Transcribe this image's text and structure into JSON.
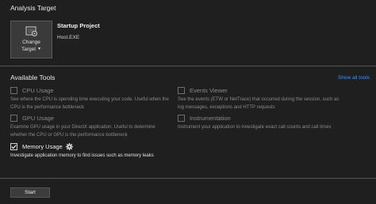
{
  "analysis_target": {
    "title": "Analysis Target",
    "change_target_line1": "Change",
    "change_target_line2": "Target",
    "project_title": "Startup Project",
    "project_exe": "Host.EXE"
  },
  "available_tools": {
    "title": "Available Tools",
    "show_all": "Show all tools",
    "tools": [
      {
        "label": "CPU Usage",
        "checked": false,
        "enabled": false,
        "description": "See where the CPU is spending time executing your code. Useful when the CPU is the performance bottleneck"
      },
      {
        "label": "GPU Usage",
        "checked": false,
        "enabled": false,
        "description": "Examine GPU usage in your DirectX application. Useful to determine whether the CPU or GPU is the performance bottleneck"
      },
      {
        "label": "Memory Usage",
        "checked": true,
        "enabled": true,
        "description": "Investigate application memory to find issues such as memory leaks"
      },
      {
        "label": "Events Viewer",
        "checked": false,
        "enabled": false,
        "description": "See the events (ETW or NetTrace) that occurred during the session, such as log messages, exceptions and HTTP requests"
      },
      {
        "label": "Instrumentation",
        "checked": false,
        "enabled": false,
        "description": "Instrument your application to investigate exact call counts and call times"
      }
    ]
  },
  "start_label": "Start",
  "icons": {
    "target": "target-settings-icon",
    "checkmark": "checkmark-icon",
    "gear": "gear-icon",
    "caret": "caret-down-icon"
  }
}
